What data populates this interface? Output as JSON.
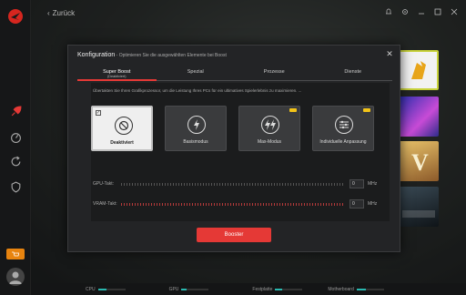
{
  "nav": {
    "back_label": "Zurück"
  },
  "modal": {
    "title": "Konfiguration",
    "subtitle": " - Optimieren Sie die ausgewählten Elemente bei Boost",
    "close_label": "✕",
    "tabs": [
      {
        "label": "Super Boost",
        "sublabel": "(Deaktiviert)",
        "active": true
      },
      {
        "label": "Spezial",
        "sublabel": "",
        "active": false
      },
      {
        "label": "Prozesse",
        "sublabel": "",
        "active": false
      },
      {
        "label": "Dienste",
        "sublabel": "",
        "active": false
      }
    ],
    "description": "Übertakten Sie Ihren Grafikprozessor, um die Leistung Ihres PCs für ein ultimatives Spielerlebnis zu maximieren. ...",
    "modes": [
      {
        "label": "Deaktiviert",
        "icon": "ban-icon",
        "selected": true,
        "badge": false
      },
      {
        "label": "Basismodus",
        "icon": "lightning-icon",
        "selected": false,
        "badge": false
      },
      {
        "label": "Max-Modus",
        "icon": "double-lightning-icon",
        "selected": false,
        "badge": true
      },
      {
        "label": "Individuelle Anpassung",
        "icon": "sliders-icon",
        "selected": false,
        "badge": true
      }
    ],
    "sliders": {
      "gpu": {
        "label": "GPU-Takt:",
        "value": "0",
        "unit": "MHz"
      },
      "vram": {
        "label": "VRAM-Takt:",
        "value": "0",
        "unit": "MHz"
      }
    },
    "booster_label": "Booster"
  },
  "status_bar": {
    "cpu": {
      "label": "CPU",
      "level": 0.3
    },
    "gpu": {
      "label": "GPU",
      "level": 0.2
    },
    "disk": {
      "label": "Festplatte",
      "level": 0.25
    },
    "board": {
      "label": "Motherboard",
      "level": 0.35
    }
  },
  "colors": {
    "accent": "#e53936",
    "badge": "#f2c318",
    "status": "#2ab8b0"
  }
}
